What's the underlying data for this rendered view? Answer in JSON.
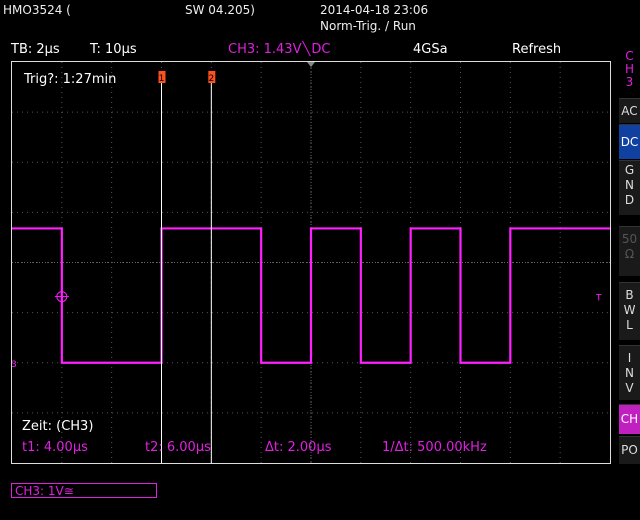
{
  "header": {
    "model": "HMO3524 (",
    "sw": "SW 04.205)",
    "datetime": "2014-04-18 23:06",
    "trig_mode": "Norm-Trig. / Run"
  },
  "info_bar": {
    "timebase": "TB: 2µs",
    "trig_time": "T: 10µs",
    "channel": "CH3: 1.43V",
    "coupling": "DC",
    "sample_rate": "4GSa",
    "mode": "Refresh"
  },
  "screen": {
    "trig_status": "Trig?: 1:27min",
    "cursor1_label": "1",
    "cursor2_label": "2",
    "zeit_label": "Zeit: (CH3)",
    "t1": "t1: 4.00µs",
    "t2": "t2: 6.00µs",
    "dt": "Δt: 2.00µs",
    "inv_dt": "1/Δt: 500.00kHz",
    "ch_marker": "3",
    "trig_marker": "T"
  },
  "side_menu": {
    "ch_title": [
      "C",
      "H",
      "3"
    ],
    "ac": "AC",
    "dc": "DC",
    "gnd": [
      "G",
      "N",
      "D"
    ],
    "ohm": [
      "50",
      "Ω"
    ],
    "bwl": [
      "B",
      "W",
      "L"
    ],
    "inv": [
      "I",
      "N",
      "V"
    ],
    "ch": "CH",
    "po": "PO"
  },
  "bottom": {
    "ch3_scale": "CH3: 1V≅"
  },
  "colors": {
    "trace": "#ff20ff",
    "cursor": "#ffffff",
    "marker": "#ff5020"
  },
  "waveform": {
    "high_level": 0.68,
    "low_level": -2.0,
    "vertical_divisions": 8,
    "horizontal_divisions": 12,
    "segments": [
      {
        "t0": 0.0,
        "t1": 1.0,
        "level": "high"
      },
      {
        "t0": 1.0,
        "t1": 3.0,
        "level": "low"
      },
      {
        "t0": 3.0,
        "t1": 5.0,
        "level": "high"
      },
      {
        "t0": 5.0,
        "t1": 6.0,
        "level": "low"
      },
      {
        "t0": 6.0,
        "t1": 7.0,
        "level": "high"
      },
      {
        "t0": 7.0,
        "t1": 8.0,
        "level": "low"
      },
      {
        "t0": 8.0,
        "t1": 9.0,
        "level": "high"
      },
      {
        "t0": 9.0,
        "t1": 10.0,
        "level": "low"
      },
      {
        "t0": 10.0,
        "t1": 12.0,
        "level": "high"
      }
    ],
    "cursor1_div": 3.0,
    "cursor2_div": 4.0
  }
}
